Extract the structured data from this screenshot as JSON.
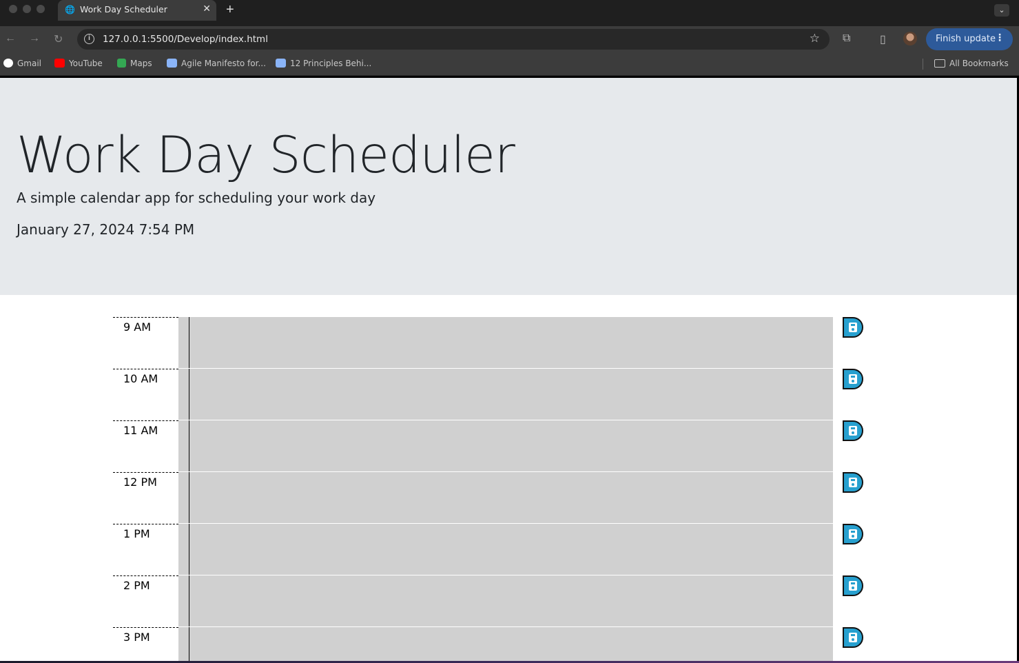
{
  "browser": {
    "tab_title": "Work Day Scheduler",
    "url": "127.0.0.1:5500/Develop/index.html",
    "finish_update": "Finish update",
    "bookmarks": [
      {
        "label": "Gmail",
        "icon": "google-icon",
        "color": "#ffffff"
      },
      {
        "label": "YouTube",
        "icon": "youtube-icon",
        "color": "#ff0000"
      },
      {
        "label": "Maps",
        "icon": "maps-icon",
        "color": "#34a853"
      },
      {
        "label": "Agile Manifesto for...",
        "icon": "agile-icon",
        "color": "#8ab4f8"
      },
      {
        "label": "12 Principles Behi...",
        "icon": "agile-icon",
        "color": "#8ab4f8"
      }
    ],
    "all_bookmarks": "All Bookmarks"
  },
  "header": {
    "title": "Work Day Scheduler",
    "lead": "A simple calendar app for scheduling your work day",
    "current_day": "January 27, 2024 7:54 PM"
  },
  "schedule": [
    {
      "hour": "9 AM",
      "text": ""
    },
    {
      "hour": "10 AM",
      "text": ""
    },
    {
      "hour": "11 AM",
      "text": ""
    },
    {
      "hour": "12 PM",
      "text": ""
    },
    {
      "hour": "1 PM",
      "text": ""
    },
    {
      "hour": "2 PM",
      "text": ""
    },
    {
      "hour": "3 PM",
      "text": ""
    }
  ],
  "colors": {
    "past": "#d0d0d0",
    "save_button": "#27a0cf",
    "jumbotron": "#e6e9ec"
  }
}
